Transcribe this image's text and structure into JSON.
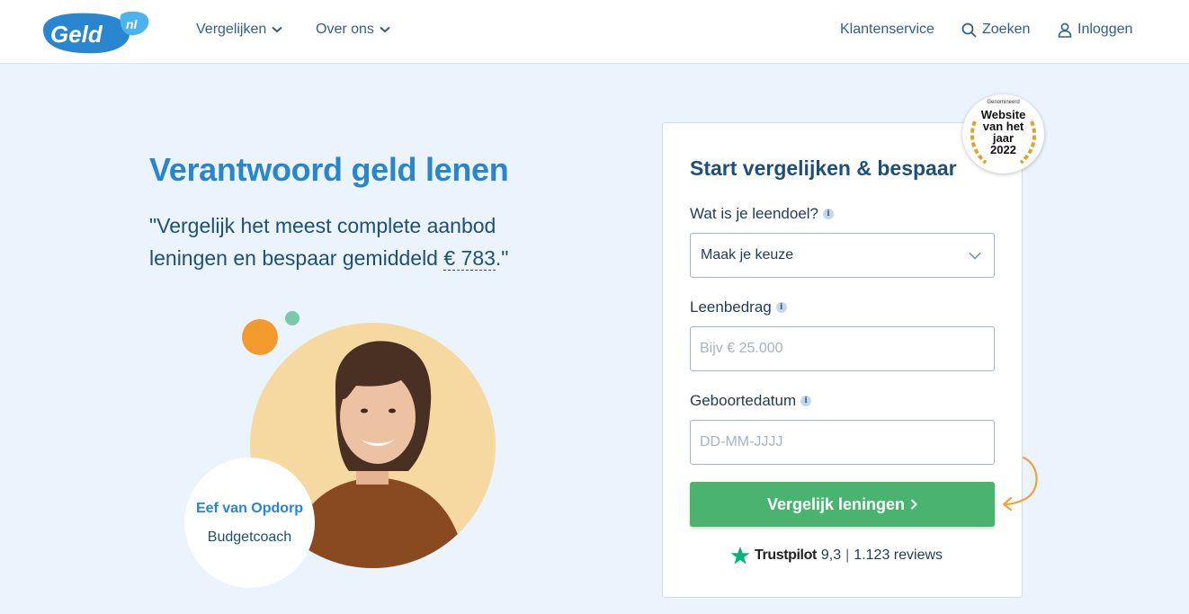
{
  "header": {
    "logo_text": "Geld",
    "logo_suffix": "nl",
    "nav": {
      "vergelijken": "Vergelijken",
      "over_ons": "Over ons",
      "klantenservice": "Klantenservice",
      "zoeken": "Zoeken",
      "inloggen": "Inloggen"
    },
    "icons": [
      "chevron-down-icon",
      "search-icon",
      "user-icon"
    ]
  },
  "hero": {
    "title": "Verantwoord geld lenen",
    "quote_before": "\"Vergelijk het meest complete aanbod leningen en bespaar gemiddeld ",
    "quote_amount": "€ 783",
    "quote_after": ".\""
  },
  "coach": {
    "name": "Eef van Opdorp",
    "role": "Budgetcoach"
  },
  "form": {
    "title": "Start vergelijken & bespaar",
    "leendoel_label": "Wat is je leendoel?",
    "leendoel_value": "Maak je keuze",
    "leenbedrag_label": "Leenbedrag",
    "leenbedrag_placeholder": "Bijv € 25.000",
    "geboortedatum_label": "Geboortedatum",
    "geboortedatum_placeholder": "DD-MM-JJJJ",
    "submit_label": "Vergelijk leningen",
    "info_glyph": "i"
  },
  "trustpilot": {
    "brand": "Trustpilot",
    "score": "9,3",
    "separator": "|",
    "reviews": "1.123 reviews"
  },
  "badge": {
    "small": "Genomineerd",
    "text": "Website\nvan het\njaar\n2022"
  },
  "colors": {
    "brand_blue": "#2a85cf",
    "navy": "#1d4f7a",
    "background": "#ebf3fd",
    "cta_green": "#4bb370",
    "accent_orange": "#f39a2f",
    "accent_green": "#7cc8a8",
    "photo_bg": "#f6d9a0"
  }
}
